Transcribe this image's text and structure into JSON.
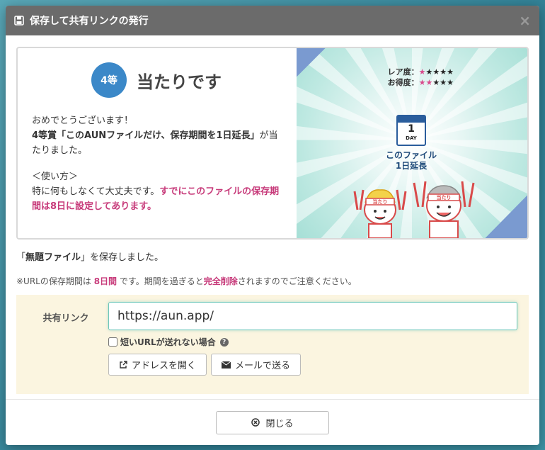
{
  "modal": {
    "title": "保存して共有リンクの発行",
    "close_symbol": "×"
  },
  "prize": {
    "rank": "4等",
    "heading": "当たりです",
    "message_line1": "おめでとうございます！",
    "message_bold": "4等賞「このAUNファイルだけ、保存期間を1日延長」",
    "message_tail": "が当たりました。",
    "usage_title": "＜使い方＞",
    "usage_text": "特に何もしなくて大丈夫です。",
    "usage_pink": "すでにこのファイルの保存期間は8日に設定してあります。",
    "rarity_label": "レア度：",
    "rarity_stars": 1,
    "value_label": "お得度：",
    "value_stars": 2,
    "stars_total": 5,
    "calendar_number": "1",
    "calendar_unit": "DAY",
    "caption_line1": "このファイル",
    "caption_line2": "1日延長",
    "char1_headband": "当たり",
    "char2_headband": "当たり"
  },
  "saved": {
    "prefix": "「",
    "filename": "無題ファイル",
    "suffix": "」を保存しました。"
  },
  "expiry": {
    "prefix": "※URLの保存期間は",
    "period": "8日間",
    "middle": "です。期間を過ぎると",
    "deletion": "完全削除",
    "suffix": "されますのでご注意ください。"
  },
  "share": {
    "label": "共有リンク",
    "url": "https://aun.app/",
    "short_url_checkbox_label": "短いURLが送れない場合",
    "short_url_checked": false,
    "open_address_label": "アドレスを開く",
    "send_mail_label": "メールで送る"
  },
  "footer": {
    "close_label": "閉じる"
  },
  "colors": {
    "header_bg": "#6b6b6b",
    "rank_circle": "#3b88c8",
    "accent_pink": "#c73a7a",
    "share_bg": "#fbf5e0",
    "input_border": "#6cc6b9"
  }
}
